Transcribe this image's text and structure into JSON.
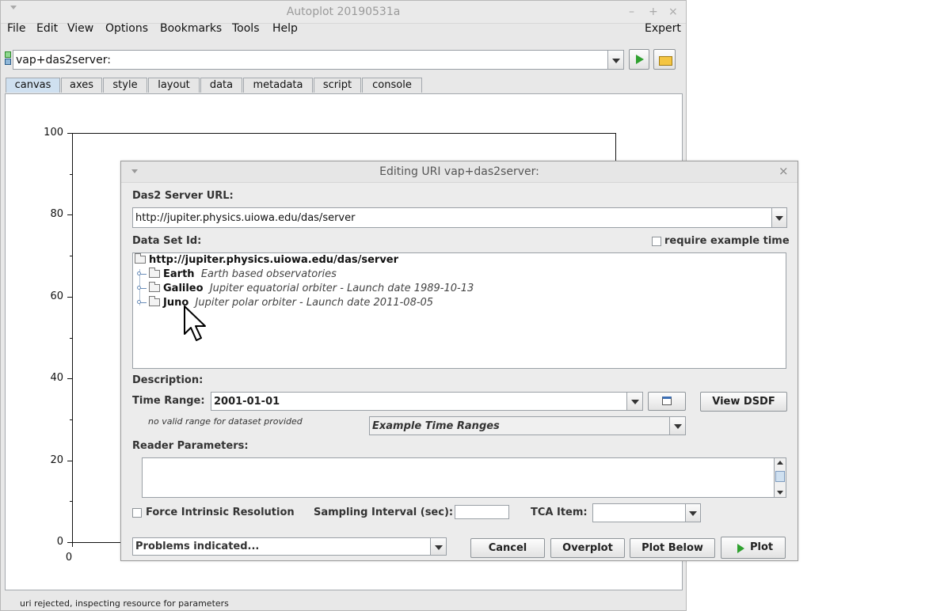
{
  "main": {
    "title": "Autoplot 20190531a",
    "menu": [
      "File",
      "Edit",
      "View",
      "Options",
      "Bookmarks",
      "Tools",
      "Help"
    ],
    "expert_label": "Expert",
    "uri_value": "vap+das2server:",
    "tabs": [
      "canvas",
      "axes",
      "style",
      "layout",
      "data",
      "metadata",
      "script",
      "console"
    ],
    "active_tab": "canvas",
    "status_text": "uri rejected, inspecting resource for parameters"
  },
  "chart_data": {
    "type": "line",
    "series": [],
    "x_tick_labels": [
      "0"
    ],
    "y_tick_labels": [
      "100",
      "80",
      "60",
      "40",
      "20",
      "0"
    ],
    "ylim": [
      0,
      100
    ],
    "grid": false
  },
  "dialog": {
    "title": "Editing URI vap+das2server:",
    "server_url_label": "Das2 Server URL:",
    "server_url_value": "http://jupiter.physics.uiowa.edu/das/server",
    "dataset_id_label": "Data Set Id:",
    "require_example_label": "require example time",
    "tree": {
      "root": "http://jupiter.physics.uiowa.edu/das/server",
      "children": [
        {
          "name": "Earth",
          "desc": "Earth based observatories"
        },
        {
          "name": "Galileo",
          "desc": "Jupiter equatorial orbiter - Launch date 1989-10-13"
        },
        {
          "name": "Juno",
          "desc": "Jupiter polar orbiter - Launch date 2011-08-05"
        }
      ]
    },
    "description_label": "Description:",
    "time_range_label": "Time Range:",
    "time_range_value": "2001-01-01",
    "view_dsdf_label": "View DSDF",
    "no_valid_range_text": "no valid range for dataset provided",
    "example_ranges_label": "Example Time Ranges",
    "reader_params_label": "Reader Parameters:",
    "force_intrinsic_label": "Force Intrinsic Resolution",
    "sampling_interval_label": "Sampling Interval (sec):",
    "tca_item_label": "TCA Item:",
    "problems_label": "Problems indicated...",
    "buttons": {
      "cancel": "Cancel",
      "overplot": "Overplot",
      "plot_below": "Plot Below",
      "plot": "Plot"
    }
  }
}
